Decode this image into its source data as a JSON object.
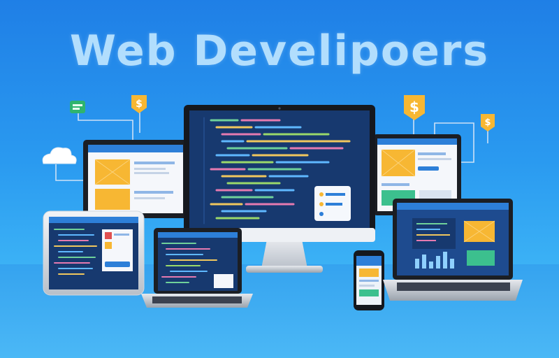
{
  "headline": "Web Develipoers",
  "icons": {
    "left_badge": "chat-icon",
    "left_dollar": "$",
    "cloud": "cloud-icon",
    "right_dollar_big": "$",
    "right_dollar_small": "$"
  },
  "colors": {
    "background_top": "#1f7fe6",
    "background_bottom": "#56c3f8",
    "accent_yellow": "#f7b733",
    "code_bg": "#17396f",
    "headline": "#bfe6ff"
  }
}
